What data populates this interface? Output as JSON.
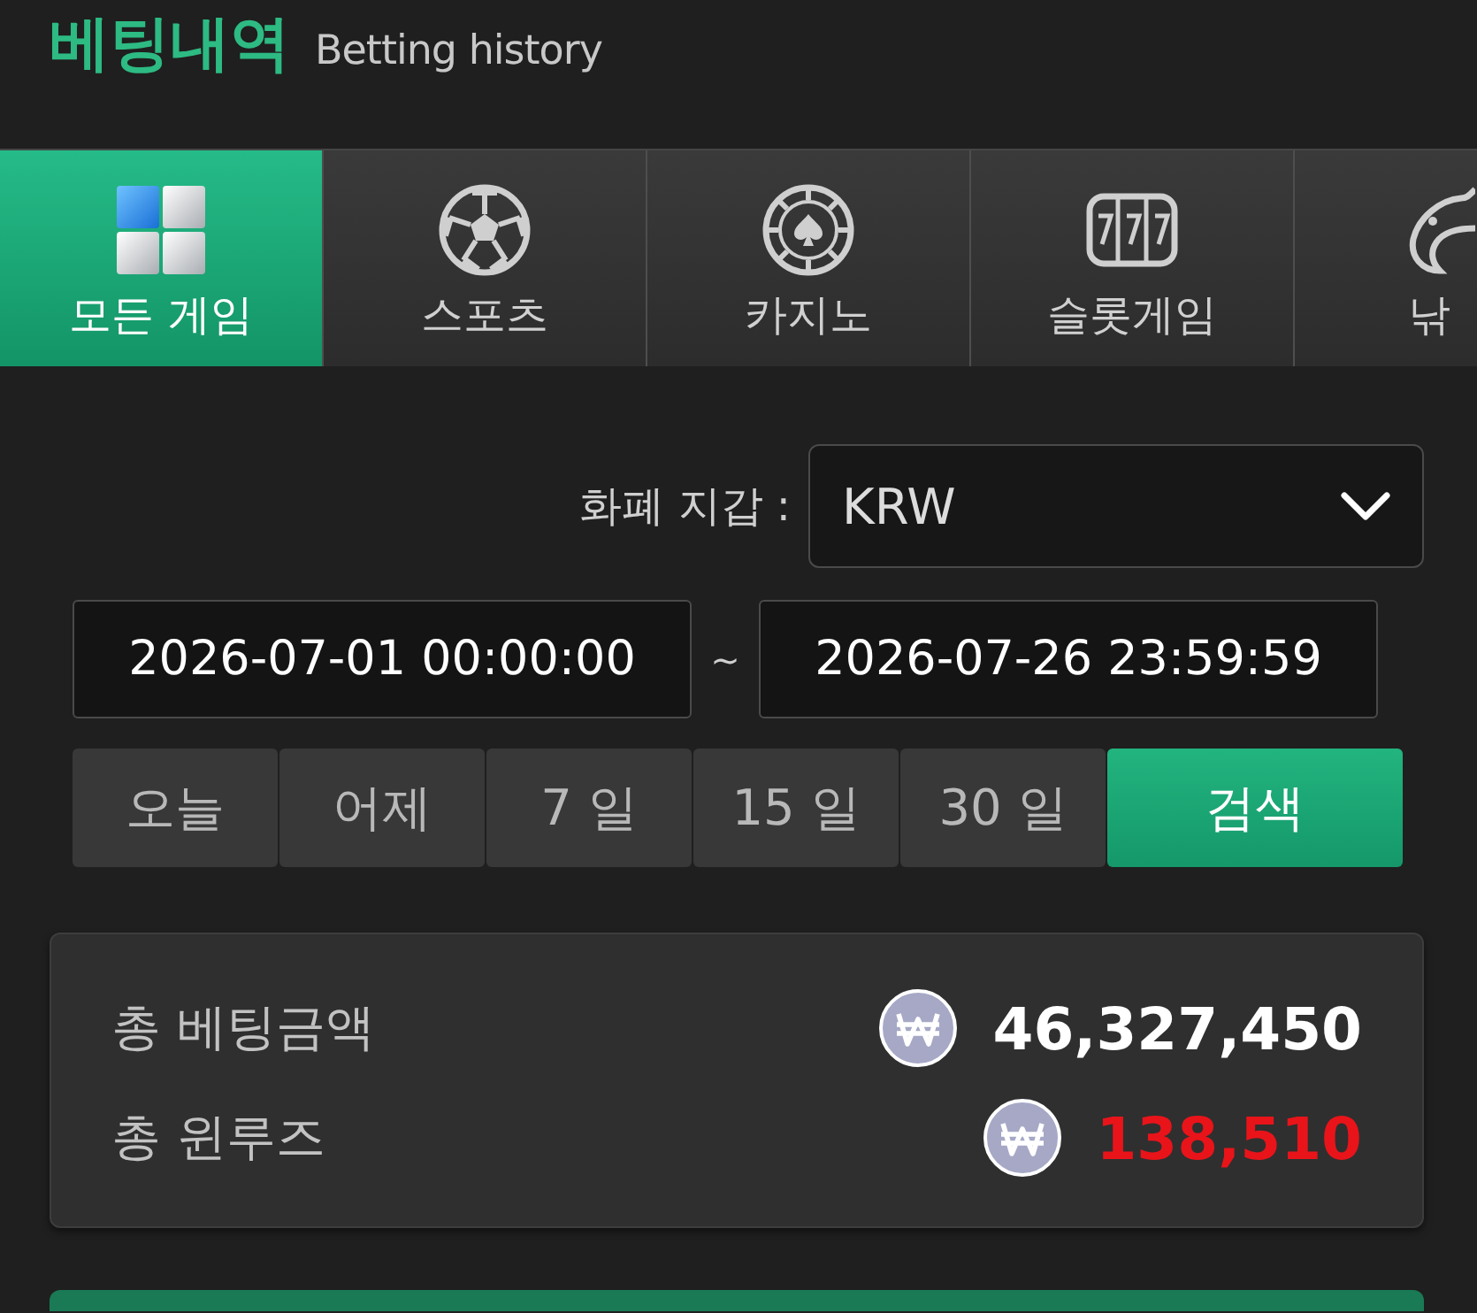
{
  "header": {
    "title": "베팅내역",
    "subtitle": "Betting history"
  },
  "game_tabs": [
    {
      "label": "모든 게임",
      "kind": "all",
      "selected": true
    },
    {
      "label": "스포츠",
      "kind": "sports",
      "selected": false
    },
    {
      "label": "카지노",
      "kind": "casino",
      "selected": false
    },
    {
      "label": "슬롯게임",
      "kind": "slot",
      "selected": false
    },
    {
      "label": "낚",
      "kind": "fishing",
      "selected": false
    }
  ],
  "currency": {
    "label": "화폐 지갑 :",
    "value": "KRW"
  },
  "date_range": {
    "from": "2026-07-01 00:00:00",
    "separator": "~",
    "to": "2026-07-26 23:59:59"
  },
  "period_buttons": [
    {
      "label": "오늘",
      "kind": "period"
    },
    {
      "label": "어제",
      "kind": "period"
    },
    {
      "label": "7 일",
      "kind": "period"
    },
    {
      "label": "15 일",
      "kind": "period"
    },
    {
      "label": "30 일",
      "kind": "period"
    },
    {
      "label": "검색",
      "kind": "search"
    }
  ],
  "summary": [
    {
      "label": "총 베팅금액",
      "value": "46,327,450",
      "color": "#ffffff"
    },
    {
      "label": "총 윈루즈",
      "value": "138,510",
      "color": "#e8141a"
    }
  ]
}
